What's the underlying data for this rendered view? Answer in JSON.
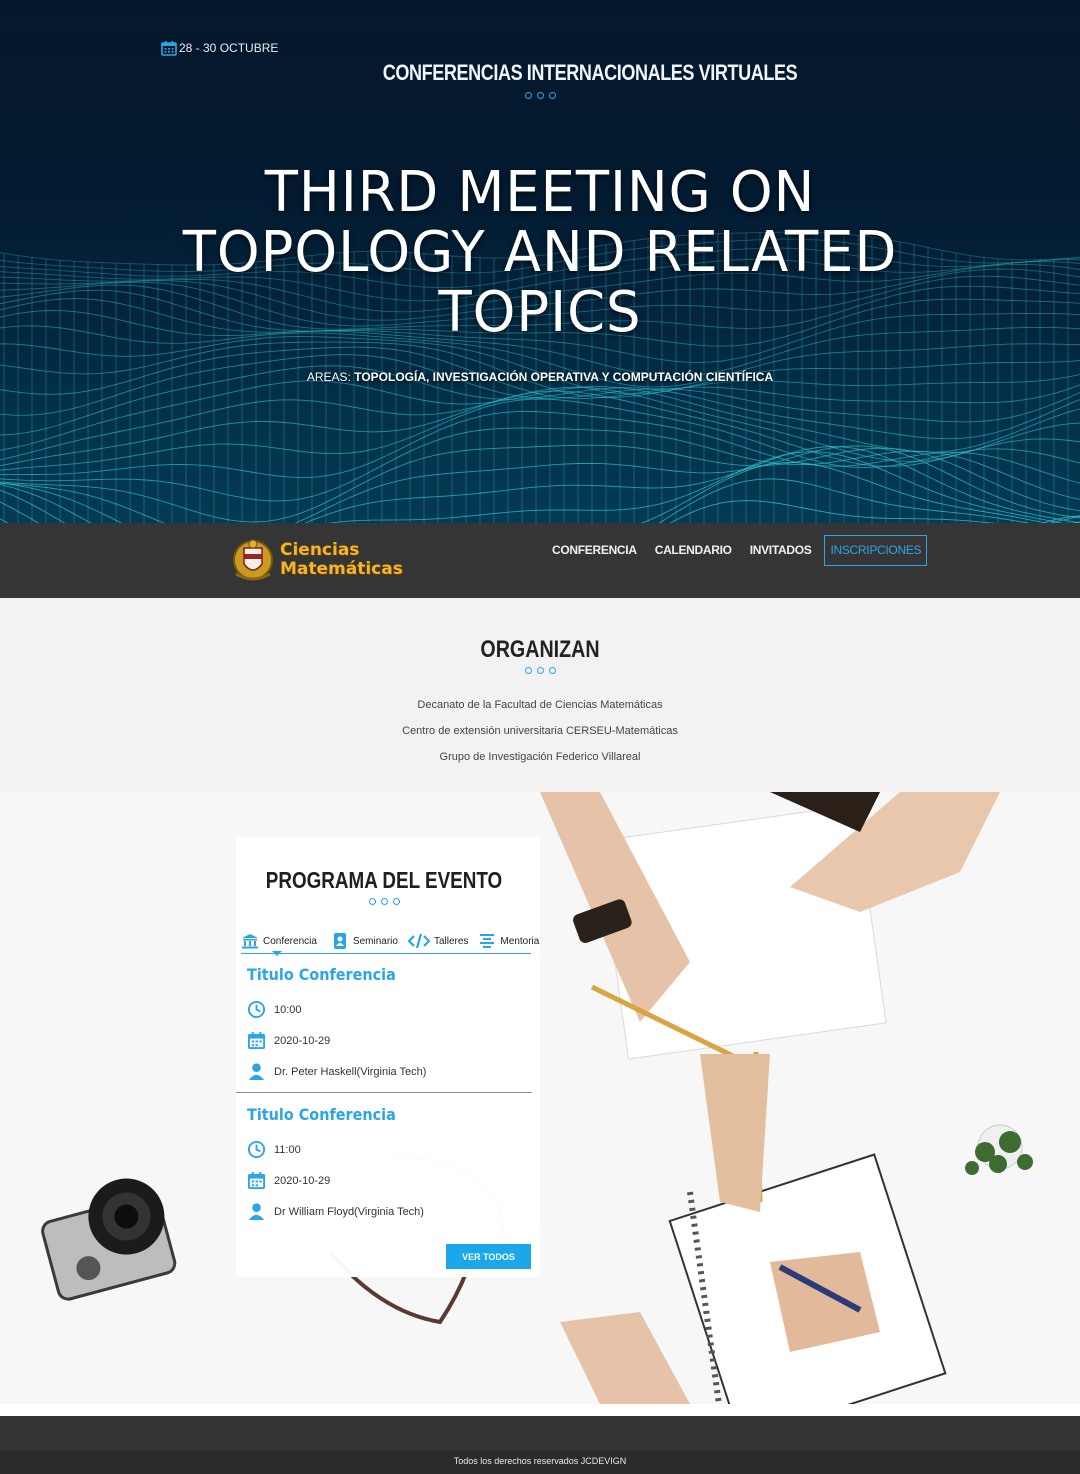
{
  "hero": {
    "date": "28 - 30 OCTUBRE",
    "conference": "CONFERENCIAS INTERNACIONALES VIRTUALES",
    "title_line1": "THIRD MEETING ON",
    "title_line2": "TOPOLOGY AND RELATED",
    "title_line3": "TOPICS",
    "areas_label": "AREAS:",
    "areas_value": "TOPOLOGÍA, INVESTIGACIÓN OPERATIVA Y COMPUTACIÓN CIENTÍFICA"
  },
  "nav": {
    "logo_line1": "Ciencias",
    "logo_line2": "Matemáticas",
    "items": [
      {
        "label": "CONFERENCIA"
      },
      {
        "label": "CALENDARIO"
      },
      {
        "label": "INVITADOS"
      },
      {
        "label": "INSCRIPCIONES"
      }
    ]
  },
  "organizan": {
    "title": "ORGANIZAN",
    "items": [
      "Decanato de la Facultad de Ciencias Matemáticas",
      "Centro de extensión universitaria CERSEU-Matemáticas",
      "Grupo de Investigación Federico Villareal"
    ]
  },
  "programa": {
    "title": "PROGRAMA DEL EVENTO",
    "tabs": [
      "Conferencia",
      "Seminario",
      "Talleres",
      "Mentoria"
    ],
    "events": [
      {
        "title": "Titulo Conferencia",
        "time": "10:00",
        "date": "2020-10-29",
        "speaker": "Dr. Peter Haskell(Virginia Tech)"
      },
      {
        "title": "Titulo Conferencia",
        "time": "11:00",
        "date": "2020-10-29",
        "speaker": "Dr William Floyd(Virginia Tech)"
      }
    ],
    "button": "VER TODOS"
  },
  "footer": {
    "copyright": "Todos los derechos reservados JCDEVIGN"
  },
  "colors": {
    "accent": "#2aa6e8",
    "nav_bg": "#353535",
    "logo_gold": "#f2b625",
    "hero_mesh": "#2fc7d6"
  }
}
